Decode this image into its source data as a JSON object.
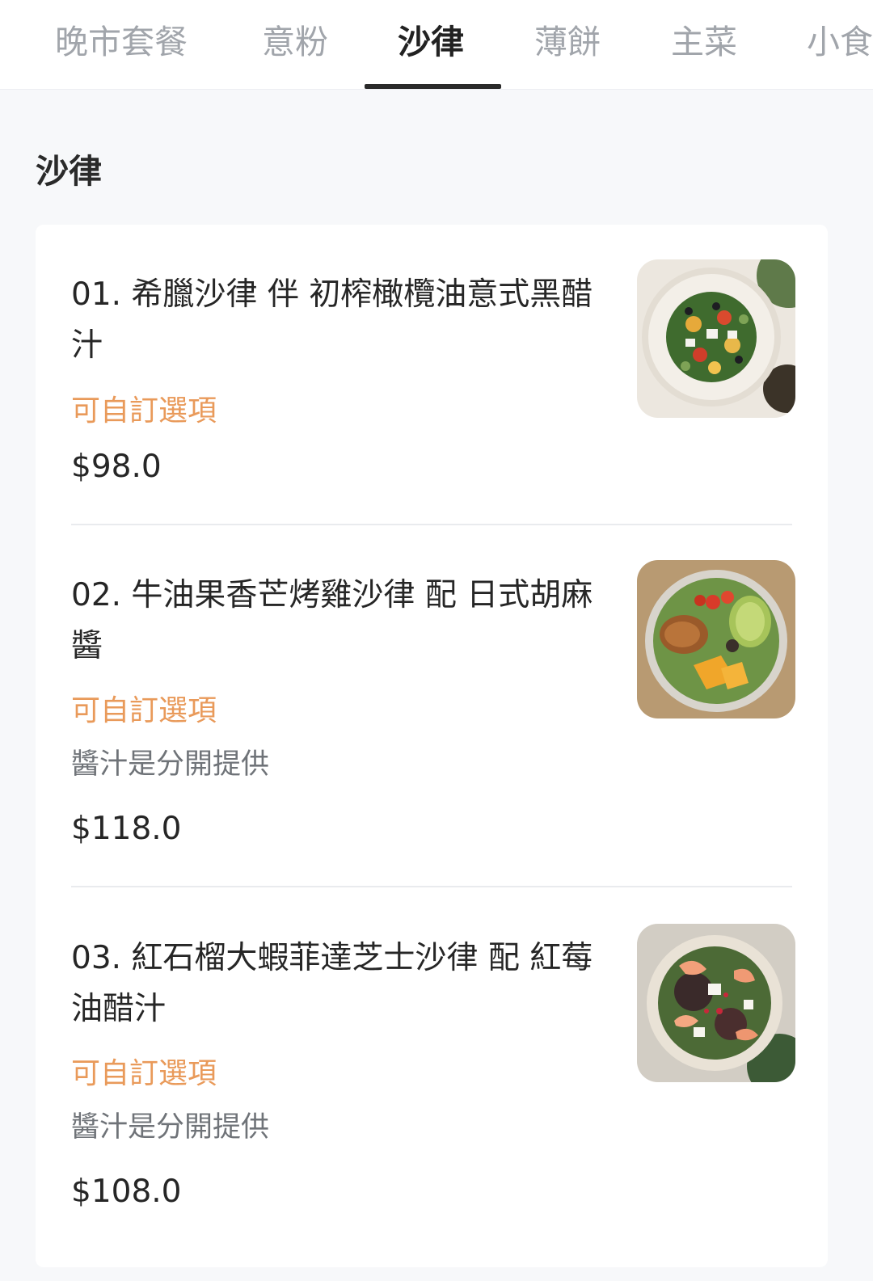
{
  "tabs": [
    {
      "label": "晚市套餐",
      "active": false
    },
    {
      "label": "意粉",
      "active": false
    },
    {
      "label": "沙律",
      "active": true
    },
    {
      "label": "薄餅",
      "active": false
    },
    {
      "label": "主菜",
      "active": false
    },
    {
      "label": "小食",
      "active": false
    }
  ],
  "section": {
    "title": "沙律"
  },
  "items": [
    {
      "name": "01. 希臘沙律 伴 初榨橄欖油意式黑醋汁",
      "tag": "可自訂選項",
      "price": "$98.0",
      "photo_icon": "greek-salad-photo"
    },
    {
      "name": "02. 牛油果香芒烤雞沙律 配 日式胡麻醬",
      "tag": "可自訂選項",
      "note": "醬汁是分開提供",
      "price": "$118.0",
      "photo_icon": "avocado-chicken-salad-photo"
    },
    {
      "name": "03. 紅石榴大蝦菲達芝士沙律 配 紅莓油醋汁",
      "tag": "可自訂選項",
      "note": "醬汁是分開提供",
      "price": "$108.0",
      "photo_icon": "shrimp-feta-salad-photo"
    }
  ],
  "colors": {
    "accent_tag": "#e99a5a",
    "active_tab": "#222222",
    "inactive_tab": "#a1a5ab",
    "background": "#f7f8fa"
  }
}
